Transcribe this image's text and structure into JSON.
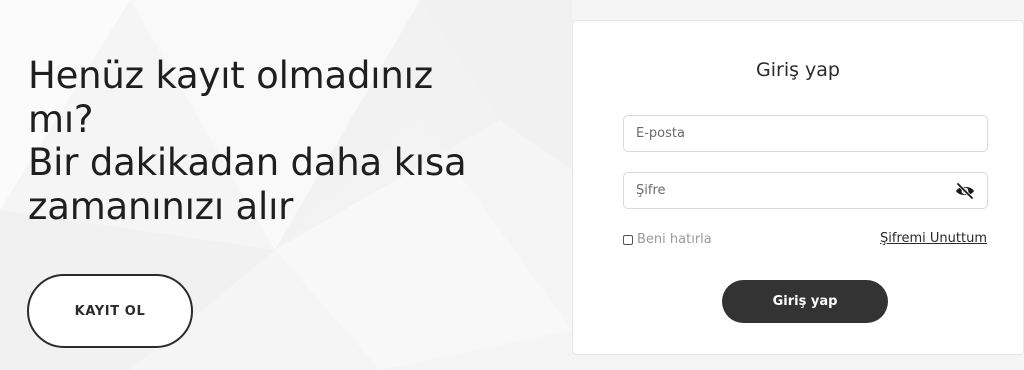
{
  "promo": {
    "heading": "Henüz kayıt olmadınız mı? Bir dakikadan daha kısa zamanınızı alır",
    "heading_line1": "Henüz kayıt olmadınız",
    "heading_line2": "mı?",
    "heading_line3": "Bir dakikadan daha kısa",
    "heading_line4": "zamanınızı alır",
    "register_label": "KAYIT OL"
  },
  "login": {
    "title": "Giriş yap",
    "email_placeholder": "E-posta",
    "email_value": "",
    "password_placeholder": "Şifre",
    "password_value": "",
    "password_toggle_icon": "eye-slash-icon",
    "remember_label": "Beni hatırla",
    "remember_checked": false,
    "forgot_label": "Şifremi Unuttum",
    "submit_label": "Giriş yap"
  },
  "colors": {
    "background": "#f5f5f5",
    "card": "#ffffff",
    "primary_button": "#333333",
    "text": "#1f1f1f",
    "muted_text": "#9a9a9a"
  }
}
